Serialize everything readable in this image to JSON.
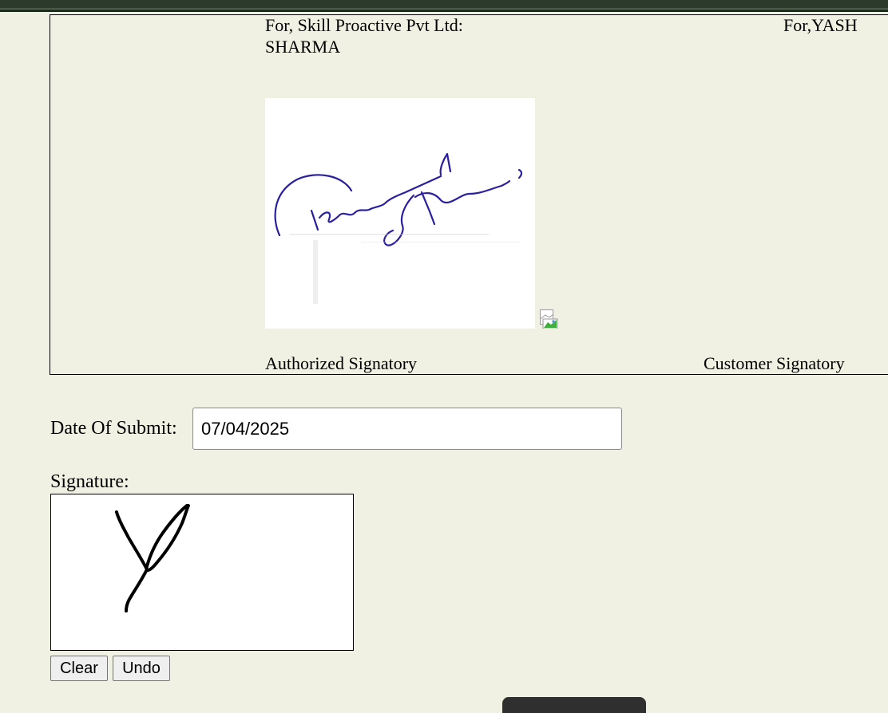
{
  "agreement": {
    "company_line": "For, Skill Proactive Pvt Ltd:",
    "customer_line": "For,YASH",
    "customer_name_wrap": "SHARMA",
    "authorized_label": "Authorized Signatory",
    "customer_label": "Customer Signatory"
  },
  "form": {
    "date_label": "Date Of Submit:",
    "date_value": "07/04/2025",
    "signature_label": "Signature:",
    "clear_label": "Clear",
    "undo_label": "Undo"
  },
  "icons": {
    "broken_image": "broken-image-icon"
  },
  "colors": {
    "background": "#f0f0e3",
    "topbar": "#2b3a2b",
    "authorized_ink": "#2a1fa0",
    "customer_ink": "#000000"
  }
}
